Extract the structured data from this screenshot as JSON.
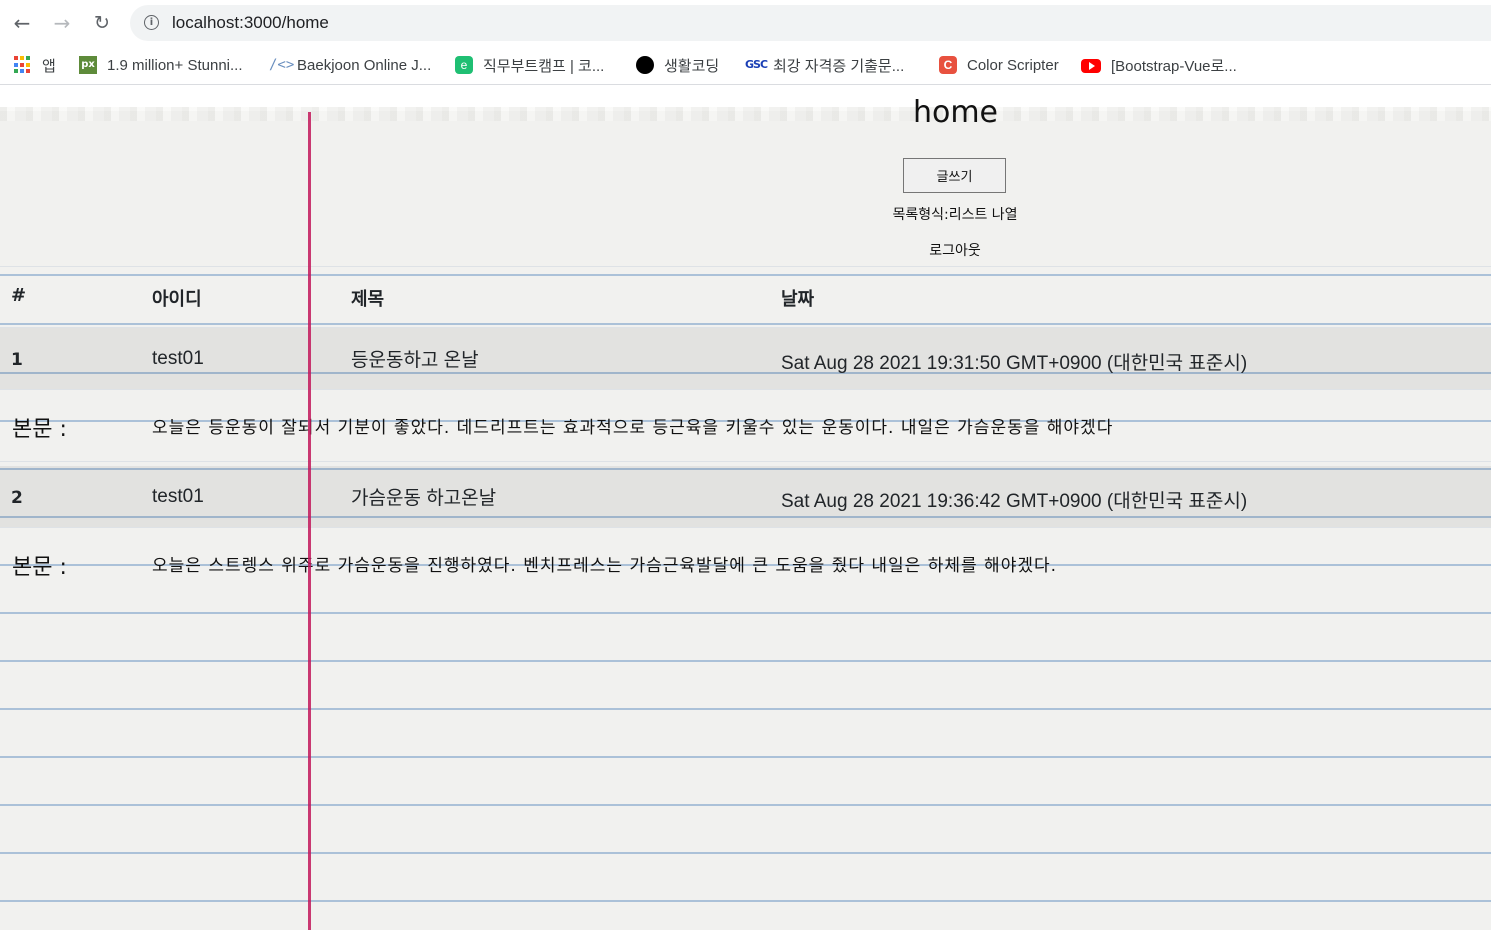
{
  "browser": {
    "nav": {
      "back_icon": "←",
      "forward_icon": "→",
      "reload_icon": "↻"
    },
    "info_icon": "i",
    "url": "localhost:3000/home"
  },
  "bookmarks": [
    {
      "label": "앱",
      "icon": "apps-grid-icon"
    },
    {
      "label": "1.9 million+ Stunni...",
      "icon": "px-icon",
      "icon_text": "px"
    },
    {
      "label": "Baekjoon Online J...",
      "icon": "code-icon",
      "icon_text": "/<>"
    },
    {
      "label": "직무부트캠프 | 코...",
      "icon": "bootcamp-icon",
      "icon_text": "e"
    },
    {
      "label": "생활코딩",
      "icon": "circle-icon"
    },
    {
      "label": "최강 자격증 기출문...",
      "icon": "gsc-icon",
      "icon_text": "GSC"
    },
    {
      "label": "Color Scripter",
      "icon": "color-scripter-icon",
      "icon_text": "C"
    },
    {
      "label": "[Bootstrap-Vue로...",
      "icon": "youtube-icon"
    }
  ],
  "page": {
    "title": "home",
    "write_button": "글쓰기",
    "list_link": "목록형식:리스트 나열",
    "logout_link": "로그아웃"
  },
  "table": {
    "headers": [
      "#",
      "아이디",
      "제목",
      "날짜"
    ],
    "body_label": "본문 :",
    "rows": [
      {
        "num": "1",
        "id": "test01",
        "title": "등운동하고 온날",
        "date": "Sat Aug 28 2021 19:31:50 GMT+0900 (대한민국 표준시)",
        "body": "오늘은 등운동이 잘되서 기분이 좋았다. 데드리프트는 효과적으로 등근육을 키울수 있는 운동이다. 내일은 가슴운동을 해야겠다"
      },
      {
        "num": "2",
        "id": "test01",
        "title": "가슴운동 하고온날",
        "date": "Sat Aug 28 2021 19:36:42 GMT+0900 (대한민국 표준시)",
        "body": "오늘은 스트렝스 위주로 가슴운동을 진행하였다. 벤치프레스는 가슴근육발달에 큰 도움을 줬다 내일은 하체를 해야겠다."
      }
    ]
  },
  "colors": {
    "margin_line": "#c2185b",
    "ruled_line": "#9fb9d3",
    "paper": "#f1f1ef"
  }
}
